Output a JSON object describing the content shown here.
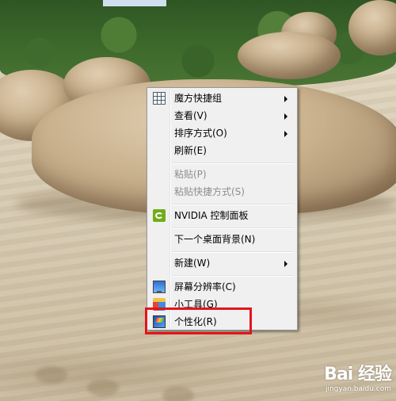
{
  "context_menu": {
    "items": [
      {
        "label": "魔方快捷组",
        "icon": "grid-icon",
        "has_submenu": true,
        "disabled": false
      },
      {
        "label": "查看(V)",
        "has_submenu": true,
        "disabled": false
      },
      {
        "label": "排序方式(O)",
        "has_submenu": true,
        "disabled": false
      },
      {
        "label": "刷新(E)",
        "has_submenu": false,
        "disabled": false
      },
      {
        "label": "粘贴(P)",
        "has_submenu": false,
        "disabled": true
      },
      {
        "label": "粘贴快捷方式(S)",
        "has_submenu": false,
        "disabled": true
      },
      {
        "label": "NVIDIA 控制面板",
        "icon": "nvidia-icon",
        "has_submenu": false,
        "disabled": false
      },
      {
        "label": "下一个桌面背景(N)",
        "has_submenu": false,
        "disabled": false
      },
      {
        "label": "新建(W)",
        "has_submenu": true,
        "disabled": false
      },
      {
        "label": "屏幕分辨率(C)",
        "icon": "monitor-icon",
        "has_submenu": false,
        "disabled": false
      },
      {
        "label": "小工具(G)",
        "icon": "gadgets-icon",
        "has_submenu": false,
        "disabled": false
      },
      {
        "label": "个性化(R)",
        "icon": "personalize-icon",
        "has_submenu": false,
        "disabled": false
      }
    ]
  },
  "highlight": {
    "target": "个性化(R)",
    "color": "#e3141b"
  },
  "watermark": {
    "logo": "Bai 经验",
    "url": "jingyan.baidu.com"
  },
  "colors": {
    "menu_bg": "#f0f0f0",
    "menu_border": "#979797",
    "disabled_text": "#8d8d8d"
  }
}
